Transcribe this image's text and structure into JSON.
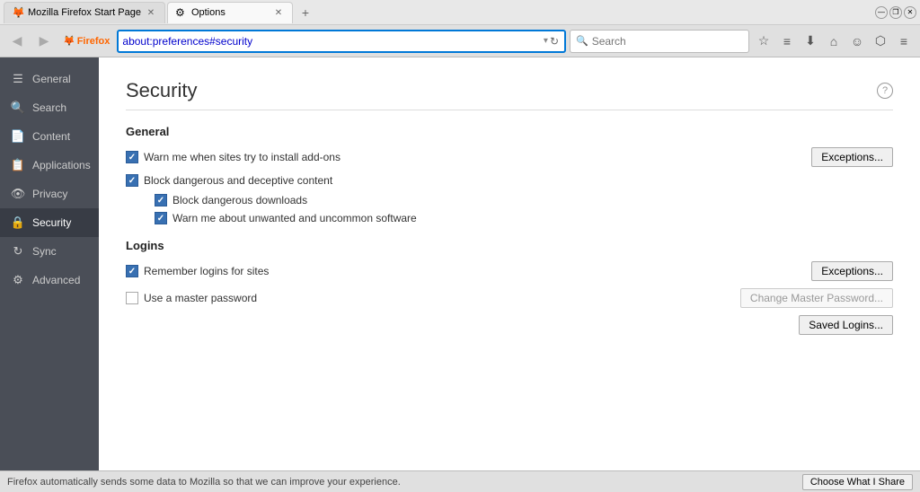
{
  "window": {
    "tab1_title": "Mozilla Firefox Start Page",
    "tab2_title": "Options",
    "tab_new_label": "+",
    "min_btn": "—",
    "restore_btn": "❐",
    "close_btn": "✕"
  },
  "navbar": {
    "back_btn": "◀",
    "forward_btn": "▶",
    "firefox_label": "Firefox",
    "address": "about:preferences#security",
    "address_dropdown": "▾",
    "reload": "↻",
    "search_placeholder": "Search",
    "bookmark_icon": "☆",
    "reader_icon": "≡",
    "download_icon": "⬇",
    "home_icon": "⌂",
    "smiley_icon": "☺",
    "pocket_icon": "⬡",
    "menu_icon": "≡"
  },
  "sidebar": {
    "items": [
      {
        "id": "general",
        "label": "General",
        "icon": "☰"
      },
      {
        "id": "search",
        "label": "Search",
        "icon": "🔍"
      },
      {
        "id": "content",
        "label": "Content",
        "icon": "📄"
      },
      {
        "id": "applications",
        "label": "Applications",
        "icon": "📋"
      },
      {
        "id": "privacy",
        "label": "Privacy",
        "icon": "👁"
      },
      {
        "id": "security",
        "label": "Security",
        "icon": "🔒"
      },
      {
        "id": "sync",
        "label": "Sync",
        "icon": "↻"
      },
      {
        "id": "advanced",
        "label": "Advanced",
        "icon": "⚙"
      }
    ]
  },
  "page": {
    "title": "Security",
    "help_tooltip": "?",
    "general_section": "General",
    "opt1_label": "Warn me when sites try to install add-ons",
    "opt1_checked": true,
    "exceptions_btn1": "Exceptions...",
    "opt2_label": "Block dangerous and deceptive content",
    "opt2_checked": true,
    "opt2a_label": "Block dangerous downloads",
    "opt2a_checked": true,
    "opt2b_label": "Warn me about unwanted and uncommon software",
    "opt2b_checked": true,
    "logins_section": "Logins",
    "opt3_label": "Remember logins for sites",
    "opt3_checked": true,
    "exceptions_btn2": "Exceptions...",
    "opt4_label": "Use a master password",
    "opt4_checked": false,
    "change_master_btn": "Change Master Password...",
    "saved_logins_btn": "Saved Logins..."
  },
  "statusbar": {
    "text": "Firefox automatically sends some data to Mozilla so that we can improve your experience.",
    "choose_btn": "Choose What I Share"
  }
}
